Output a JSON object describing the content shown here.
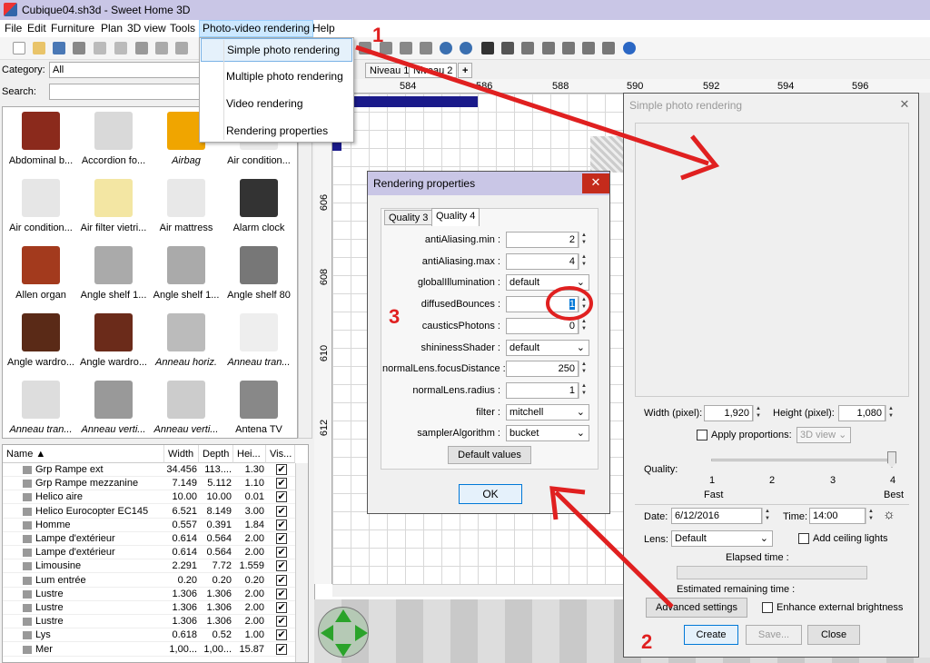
{
  "window": {
    "title": "Cubique04.sh3d - Sweet Home 3D"
  },
  "menubar": {
    "items": [
      "File",
      "Edit",
      "Furniture",
      "Plan",
      "3D view",
      "Tools",
      "Photo-video rendering",
      "Help"
    ]
  },
  "photo_menu": {
    "items": [
      "Simple photo rendering",
      "Multiple photo rendering",
      "Video rendering",
      "Rendering properties"
    ]
  },
  "left": {
    "category_label": "Category:",
    "category_value": "All",
    "search_label": "Search:"
  },
  "catalog": [
    {
      "label": "Abdominal b...",
      "italic": false
    },
    {
      "label": "Accordion fo...",
      "italic": false
    },
    {
      "label": "Airbag",
      "italic": true
    },
    {
      "label": "Air condition...",
      "italic": false
    },
    {
      "label": "Air condition...",
      "italic": false
    },
    {
      "label": "Air filter vietri...",
      "italic": false
    },
    {
      "label": "Air mattress",
      "italic": false
    },
    {
      "label": "Alarm clock",
      "italic": false
    },
    {
      "label": "Allen organ",
      "italic": false
    },
    {
      "label": "Angle shelf 1...",
      "italic": false
    },
    {
      "label": "Angle shelf 1...",
      "italic": false
    },
    {
      "label": "Angle shelf 80",
      "italic": false
    },
    {
      "label": "Angle wardro...",
      "italic": false
    },
    {
      "label": "Angle wardro...",
      "italic": false
    },
    {
      "label": "Anneau horiz.",
      "italic": true
    },
    {
      "label": "Anneau tran...",
      "italic": true
    },
    {
      "label": "Anneau tran...",
      "italic": true
    },
    {
      "label": "Anneau verti...",
      "italic": true
    },
    {
      "label": "Anneau verti...",
      "italic": true
    },
    {
      "label": "Antena TV",
      "italic": false
    }
  ],
  "furniture_table": {
    "headers": [
      "Name ▲",
      "Width",
      "Depth",
      "Hei...",
      "Vis..."
    ],
    "rows": [
      {
        "name": "Grp Rampe ext",
        "w": "34.456",
        "d": "113....",
        "h": "1.30",
        "v": true
      },
      {
        "name": "Grp Rampe mezzanine",
        "w": "7.149",
        "d": "5.112",
        "h": "1.10",
        "v": true
      },
      {
        "name": "Helico aire",
        "w": "10.00",
        "d": "10.00",
        "h": "0.01",
        "v": true
      },
      {
        "name": "Helico Eurocopter EC145",
        "w": "6.521",
        "d": "8.149",
        "h": "3.00",
        "v": true
      },
      {
        "name": "Homme",
        "w": "0.557",
        "d": "0.391",
        "h": "1.84",
        "v": true
      },
      {
        "name": "Lampe d'extérieur",
        "w": "0.614",
        "d": "0.564",
        "h": "2.00",
        "v": true
      },
      {
        "name": "Lampe d'extérieur",
        "w": "0.614",
        "d": "0.564",
        "h": "2.00",
        "v": true
      },
      {
        "name": "Limousine",
        "w": "2.291",
        "d": "7.72",
        "h": "1.559",
        "v": true
      },
      {
        "name": "Lum entrée",
        "w": "0.20",
        "d": "0.20",
        "h": "0.20",
        "v": true
      },
      {
        "name": "Lustre",
        "w": "1.306",
        "d": "1.306",
        "h": "2.00",
        "v": true
      },
      {
        "name": "Lustre",
        "w": "1.306",
        "d": "1.306",
        "h": "2.00",
        "v": true
      },
      {
        "name": "Lustre",
        "w": "1.306",
        "d": "1.306",
        "h": "2.00",
        "v": true
      },
      {
        "name": "Lys",
        "w": "0.618",
        "d": "0.52",
        "h": "1.00",
        "v": true
      },
      {
        "name": "Mer",
        "w": "1,00...",
        "d": "1,00...",
        "h": "15.87",
        "v": true
      }
    ]
  },
  "plan": {
    "tabs": [
      "Niveau 1",
      "Niveau 2",
      "+"
    ],
    "ruler_h": [
      "584",
      "586",
      "588",
      "590",
      "592",
      "594",
      "596"
    ],
    "ruler_v": [
      "606",
      "608",
      "610",
      "612"
    ]
  },
  "rendering_properties": {
    "title": "Rendering properties",
    "tabs": [
      "Quality 3",
      "Quality 4"
    ],
    "fields": [
      {
        "label": "antiAliasing.min :",
        "value": "2",
        "kind": "spin"
      },
      {
        "label": "antiAliasing.max :",
        "value": "4",
        "kind": "spin"
      },
      {
        "label": "globalIllumination :",
        "value": "default",
        "kind": "combo"
      },
      {
        "label": "diffusedBounces :",
        "value": "1",
        "kind": "spin"
      },
      {
        "label": "causticsPhotons :",
        "value": "0",
        "kind": "spin"
      },
      {
        "label": "shininessShader :",
        "value": "default",
        "kind": "combo"
      },
      {
        "label": "normalLens.focusDistance :",
        "value": "250",
        "kind": "spin"
      },
      {
        "label": "normalLens.radius :",
        "value": "1",
        "kind": "spin"
      },
      {
        "label": "filter :",
        "value": "mitchell",
        "kind": "combo"
      },
      {
        "label": "samplerAlgorithm :",
        "value": "bucket",
        "kind": "combo"
      }
    ],
    "default_button": "Default values",
    "ok_button": "OK"
  },
  "simple_photo": {
    "title": "Simple photo rendering",
    "width_label": "Width (pixel):",
    "width_value": "1,920",
    "height_label": "Height (pixel):",
    "height_value": "1,080",
    "apply_proportions": "Apply proportions:",
    "proportion_value": "3D view",
    "quality_label": "Quality:",
    "quality_ticks": [
      "1",
      "2",
      "3",
      "4"
    ],
    "quality_fast": "Fast",
    "quality_best": "Best",
    "quality_level": 4,
    "date_label": "Date:",
    "date_value": "6/12/2016",
    "time_label": "Time:",
    "time_value": "14:00",
    "lens_label": "Lens:",
    "lens_value": "Default",
    "ceiling_lights": "Add ceiling lights",
    "elapsed": "Elapsed time :",
    "remaining": "Estimated remaining time :",
    "advanced": "Advanced settings",
    "enhance": "Enhance external brightness",
    "create": "Create",
    "save": "Save...",
    "close": "Close"
  },
  "annotations": [
    "1",
    "2",
    "3"
  ]
}
